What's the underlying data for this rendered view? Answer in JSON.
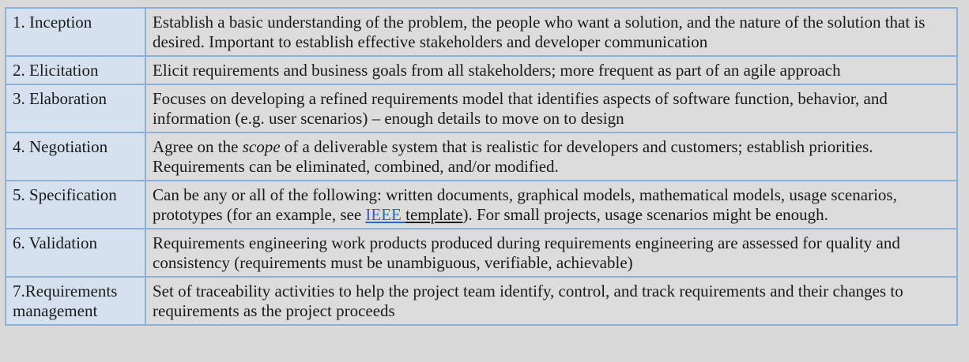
{
  "rows": [
    {
      "phase": "1. Inception",
      "description": "Establish a basic understanding of the problem, the people who want a solution, and the nature of the solution that is desired. Important to establish effective stakeholders and developer communication"
    },
    {
      "phase": "2. Elicitation",
      "description": "Elicit requirements and business goals from all stakeholders; more frequent as part of an agile approach"
    },
    {
      "phase": "3. Elaboration",
      "description": "Focuses on developing a refined requirements model that identifies aspects of software function, behavior, and information (e.g. user scenarios) – enough details to move on to design"
    },
    {
      "phase": "4. Negotiation",
      "desc_before": "Agree on the ",
      "desc_italic": "scope",
      "desc_after": " of a deliverable system that is realistic for developers and customers; establish priorities. Requirements can be eliminated, combined, and/or modified."
    },
    {
      "phase": "5. Specification",
      "desc_before": "Can be any or all of the following: written documents, graphical models, mathematical models, usage scenarios, prototypes (for an example, see ",
      "link_ieee": "IEEE ",
      "link_template": "template",
      "desc_after": "). For small projects, usage scenarios might be enough."
    },
    {
      "phase": "6. Validation",
      "description": "Requirements engineering work products produced during requirements engineering are assessed for quality and consistency (requirements must be unambiguous, verifiable, achievable)"
    },
    {
      "phase": "7.Requirements management",
      "description": "Set of traceability activities to help the project team identify, control, and track requirements and their changes to requirements as the project proceeds"
    }
  ],
  "colors": {
    "phase_cell_bg": "#d5e1ee",
    "desc_cell_bg": "#dcdcdc",
    "border": "#8fb0d6",
    "link": "#2a66c4"
  }
}
